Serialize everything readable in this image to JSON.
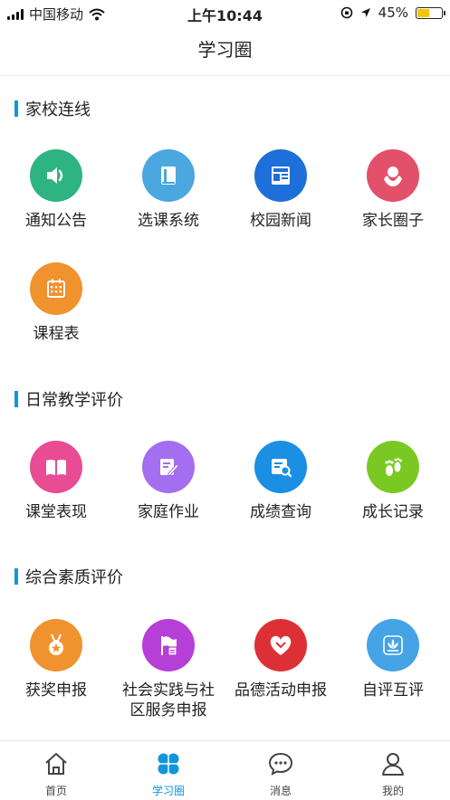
{
  "status_bar": {
    "carrier": "中国移动",
    "time": "上午10:44",
    "battery": "45%",
    "battery_level": 0.45
  },
  "header": {
    "title": "学习圈"
  },
  "sections": [
    {
      "title": "家校连线",
      "items": [
        {
          "label": "通知公告",
          "icon": "speaker-icon",
          "color": "#2db482"
        },
        {
          "label": "选课系统",
          "icon": "book-icon",
          "color": "#4aa7e0"
        },
        {
          "label": "校园新闻",
          "icon": "newspaper-icon",
          "color": "#1e6fd9"
        },
        {
          "label": "家长圈子",
          "icon": "parent-icon",
          "color": "#e2506a"
        },
        {
          "label": "课程表",
          "icon": "calendar-icon",
          "color": "#f0922e"
        }
      ]
    },
    {
      "title": "日常教学评价",
      "items": [
        {
          "label": "课堂表现",
          "icon": "open-book-icon",
          "color": "#e84c92"
        },
        {
          "label": "家庭作业",
          "icon": "edit-icon",
          "color": "#a46ef0"
        },
        {
          "label": "成绩查询",
          "icon": "search-doc-icon",
          "color": "#1a8fe3"
        },
        {
          "label": "成长记录",
          "icon": "footprint-icon",
          "color": "#7ac922"
        }
      ]
    },
    {
      "title": "综合素质评价",
      "items": [
        {
          "label": "获奖申报",
          "icon": "medal-icon",
          "color": "#f0922e"
        },
        {
          "label": "社会实践与社区服务申报",
          "icon": "flag-icon",
          "color": "#b63fd8"
        },
        {
          "label": "品德活动申报",
          "icon": "heart-icon",
          "color": "#dd3036"
        },
        {
          "label": "自评互评",
          "icon": "lotus-icon",
          "color": "#46a3e6"
        }
      ]
    }
  ],
  "tabbar": [
    {
      "label": "首页",
      "icon": "home-icon",
      "active": false
    },
    {
      "label": "学习圈",
      "icon": "clover-icon",
      "active": true
    },
    {
      "label": "消息",
      "icon": "chat-icon",
      "active": false
    },
    {
      "label": "我的",
      "icon": "user-icon",
      "active": false
    }
  ],
  "colors": {
    "accent": "#1296db",
    "inactive_tab": "#444444"
  }
}
